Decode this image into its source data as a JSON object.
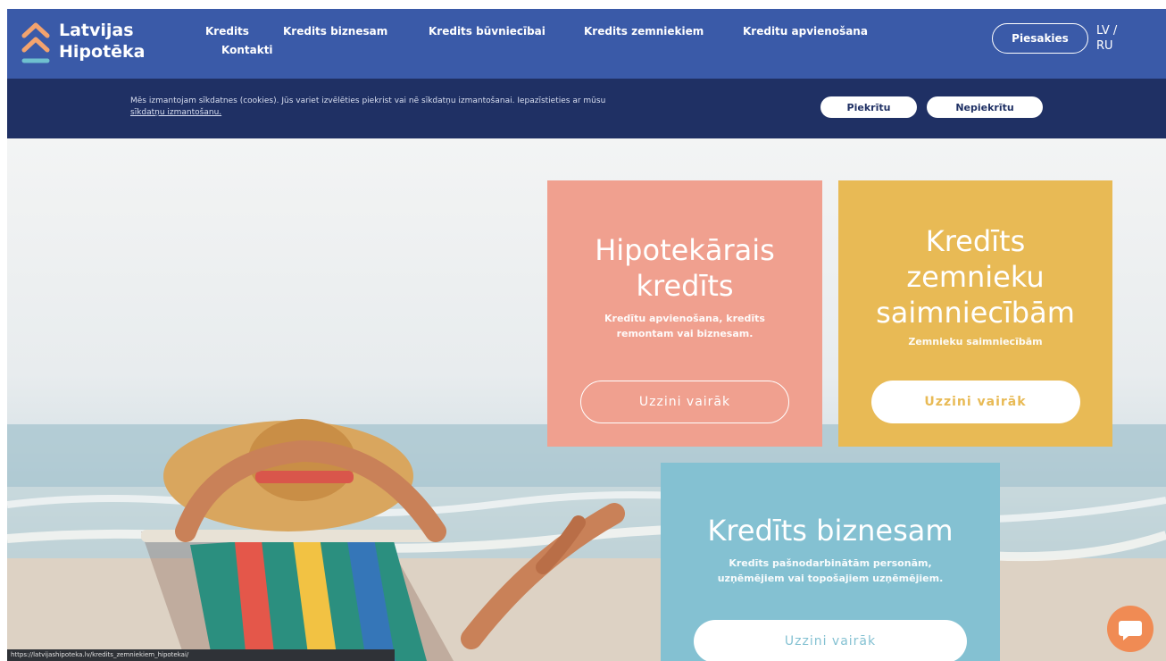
{
  "brand": {
    "line1": "Latvijas",
    "line2": "Hipotēka"
  },
  "nav": {
    "items": [
      "Kredits",
      "Kredits biznesam",
      "Kredits būvniecībai",
      "Kredits zemniekiem",
      "Kreditu apvienošana",
      "Kontakti"
    ]
  },
  "header": {
    "login_label": "Piesakies",
    "lang_lv": "LV /",
    "lang_ru": "RU"
  },
  "cookie": {
    "text": "Mēs izmantojam sīkdatnes (cookies). Jūs variet izvēlēties piekrist vai nē sīkdatņu izmantošanai. Iepazīstieties ar mūsu",
    "link": "sīkdatņu izmantošanu.",
    "accept_label": "Piekrītu",
    "decline_label": "Nepiekrītu"
  },
  "cards": [
    {
      "title_line1": "Hipotekārais",
      "title_line2": "kredīts",
      "subtitle_line1": "Kredītu apvienošana, kredīts",
      "subtitle_line2": "remontam vai biznesam.",
      "button_label": "Uzzini vairāk"
    },
    {
      "title_line1": "Kredīts",
      "title_line2": "zemnieku",
      "title_line3": "saimniecībām",
      "subtitle_line1": "Zemnieku saimniecībām",
      "button_label": "Uzzini vairāk"
    },
    {
      "title_line1": "Kredīts biznesam",
      "subtitle_line1": "Kredīts pašnodarbinātām personām,",
      "subtitle_line2": "uzņēmējiem vai topošajiem uzņēmējiem.",
      "button_label": "Uzzini vairāk"
    }
  ],
  "status": {
    "url": "https://latvijashipoteka.lv/kredits_zemniekiem_hipotekai/"
  },
  "colors": {
    "header_bg": "#3a5aa8",
    "cookie_bg": "#1f3064",
    "card_pink": "#f0a08f",
    "card_yellow": "#e8ba55",
    "card_blue": "#84c1d2",
    "chat_orange": "#f08b54"
  },
  "icons": {
    "logo": "double-chevron-up-logo-icon",
    "chat": "chat-bubble-icon"
  }
}
